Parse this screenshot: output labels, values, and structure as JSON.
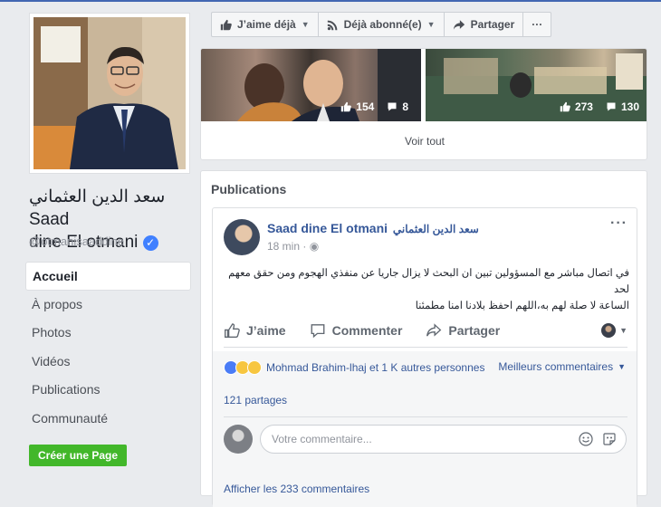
{
  "profile": {
    "name_line": "سعد الدين العثماني Saad",
    "name_line2": "dine El otmani",
    "handle": "@otmanisaaddine"
  },
  "nav": {
    "items": [
      "Accueil",
      "À propos",
      "Photos",
      "Vidéos",
      "Publications",
      "Communauté"
    ],
    "active_index": 0,
    "create_page": "Créer une Page"
  },
  "actionbar": {
    "like": "J’aime déjà",
    "subscribe": "Déjà abonné(e)",
    "share": "Partager",
    "more": "···"
  },
  "photos": {
    "items": [
      {
        "likes": "154",
        "comments": "8"
      },
      {
        "likes": "273",
        "comments": "130"
      }
    ],
    "see_all": "Voir tout"
  },
  "publications": {
    "title": "Publications",
    "post": {
      "author": "Saad dine El otmani",
      "author_ar": "سعد الدين العثماني",
      "time": "18 min",
      "more": "···",
      "text_line1": "في اتصال مباشر مع المسؤولين تبين ان البحث لا يزال جاريا عن منفذي الهجوم ومن حقق معهم لحد",
      "text_line2": "الساعة لا صلة لهم به،اللهم احفظ بلادنا امنا مطمئنا",
      "actions": {
        "like": "J’aime",
        "comment": "Commenter",
        "share": "Partager"
      },
      "reactions_text": "Mohmad Brahim-lhaj et 1 K autres personnes",
      "best_comments": "Meilleurs commentaires",
      "shares": "121 partages",
      "comment_placeholder": "Votre commentaire...",
      "view_comments": "Afficher les 233 commentaires"
    }
  },
  "colors": {
    "brand": "#4267b2",
    "link": "#365899",
    "green": "#42b72a",
    "verified": "#4080ff"
  }
}
